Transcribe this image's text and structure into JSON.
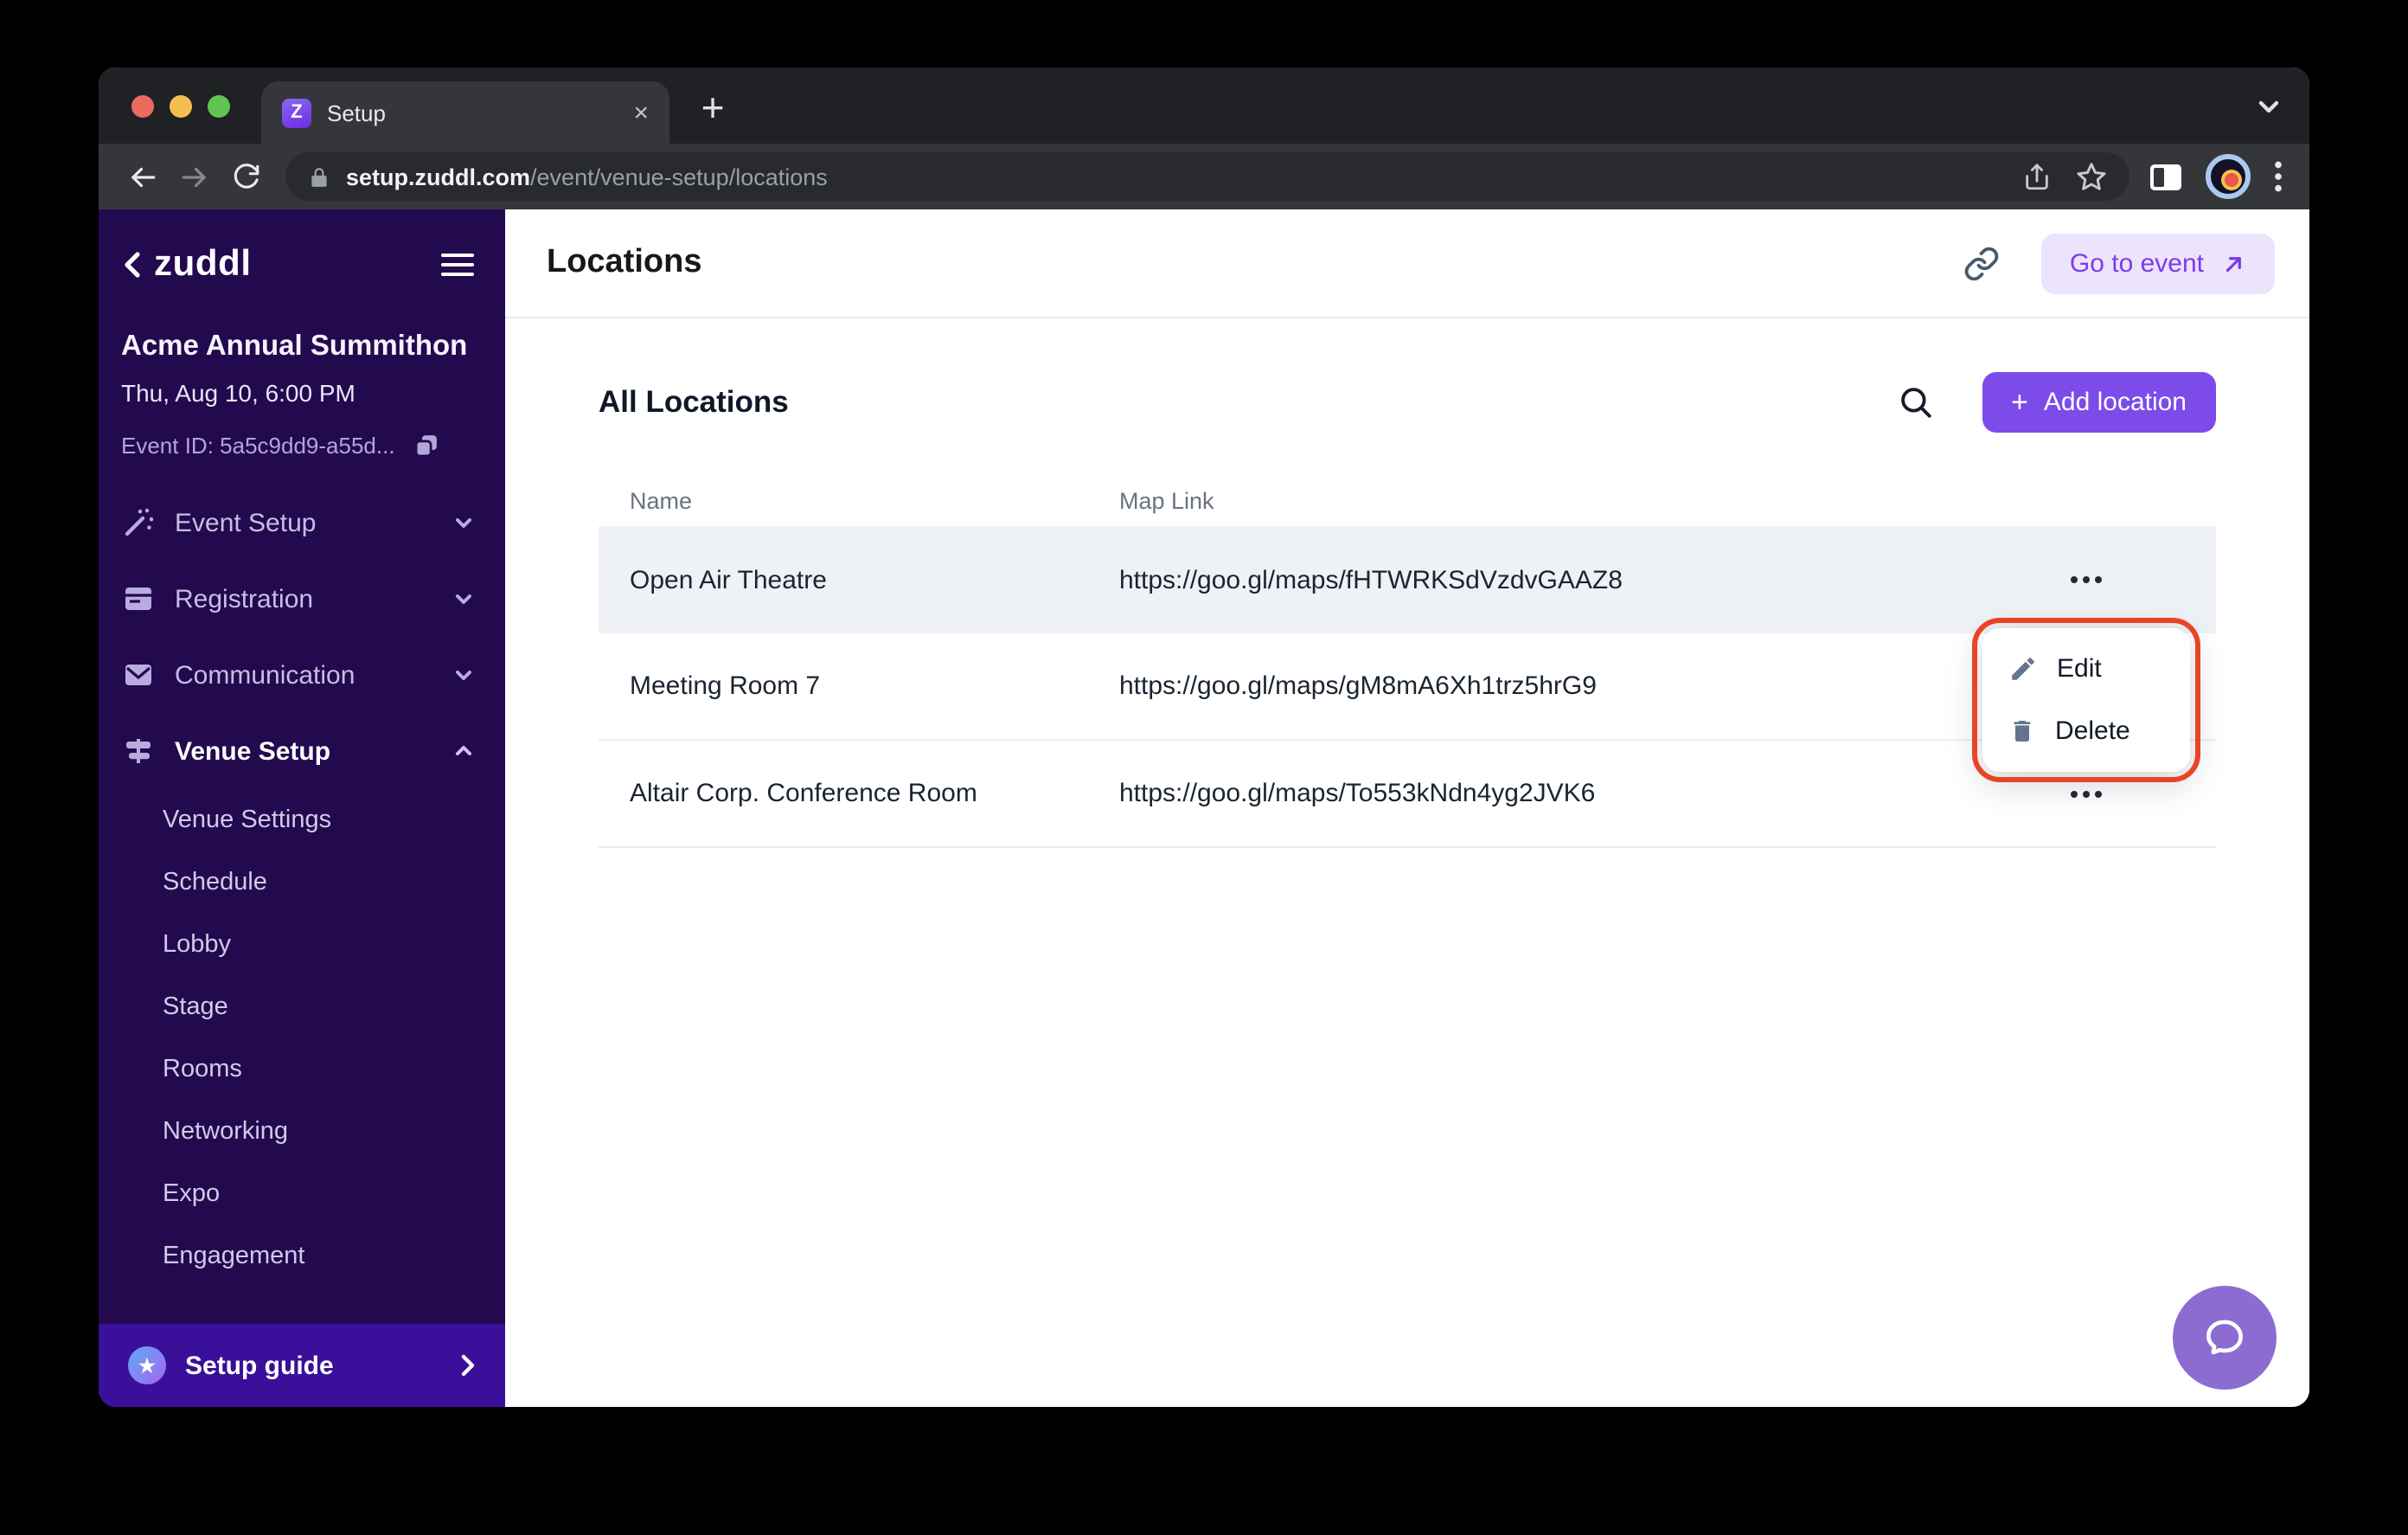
{
  "browser": {
    "tab_title": "Setup",
    "favicon_letter": "Z",
    "url_domain": "setup.zuddl.com",
    "url_path": "/event/venue-setup/locations"
  },
  "icons": {
    "plus": "+",
    "new_tab": "+",
    "close_tab": "×",
    "star": "★"
  },
  "sidebar": {
    "logo_text": "zuddl",
    "event_name": "Acme Annual Summithon",
    "event_datetime": "Thu, Aug 10, 6:00 PM",
    "event_id": "Event ID: 5a5c9dd9-a55d...",
    "nav": [
      {
        "label": "Event Setup",
        "icon": "wand-icon",
        "state": "collapsed"
      },
      {
        "label": "Registration",
        "icon": "form-icon",
        "state": "collapsed"
      },
      {
        "label": "Communication",
        "icon": "envelope-icon",
        "state": "collapsed"
      },
      {
        "label": "Venue Setup",
        "icon": "signpost-icon",
        "state": "expanded"
      }
    ],
    "venue_subnav": [
      "Venue Settings",
      "Schedule",
      "Lobby",
      "Stage",
      "Rooms",
      "Networking",
      "Expo",
      "Engagement"
    ],
    "setup_guide_label": "Setup guide"
  },
  "header": {
    "title": "Locations",
    "go_to_event_label": "Go to event"
  },
  "locations": {
    "section_title": "All Locations",
    "add_button_label": "Add location",
    "columns": [
      "Name",
      "Map Link"
    ],
    "rows": [
      {
        "name": "Open Air Theatre",
        "map_link": "https://goo.gl/maps/fHTWRKSdVzdvGAAZ8"
      },
      {
        "name": "Meeting Room 7",
        "map_link": "https://goo.gl/maps/gM8mA6Xh1trz5hrG9"
      },
      {
        "name": "Altair Corp. Conference Room",
        "map_link": "https://goo.gl/maps/To553kNdn4yg2JVK6"
      }
    ]
  },
  "context_menu": {
    "items": [
      {
        "label": "Edit",
        "icon": "pencil-icon"
      },
      {
        "label": "Delete",
        "icon": "trash-icon"
      }
    ]
  },
  "colors": {
    "accent_purple": "#7C4BEA",
    "accent_purple_light": "#ECE3FD",
    "sidebar_bg": "#23094E",
    "setup_guide_bg": "#3A0F9A",
    "row_highlight": "#EEF1F6",
    "annotation_red": "#EA4426",
    "help_bubble": "#8D6CD2"
  }
}
